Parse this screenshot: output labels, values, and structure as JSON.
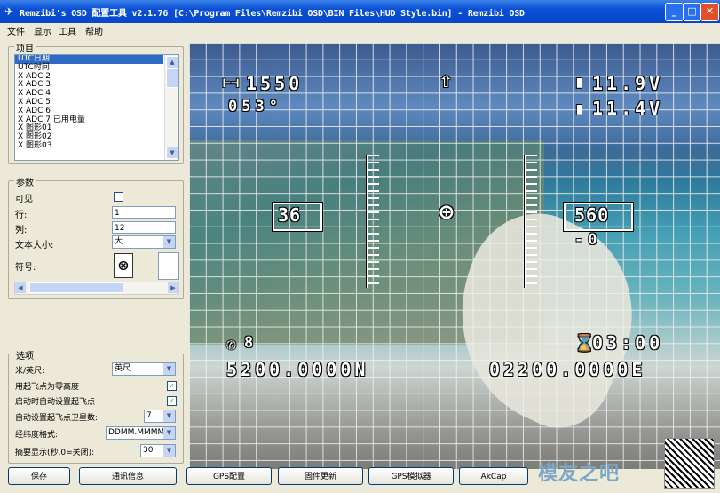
{
  "window": {
    "title": "Remzibi's OSD 配置工具 v2.1.76 [C:\\Program Files\\Remzibi OSD\\BIN Files\\HUD Style.bin] - Remzibi OSD",
    "min_label": "_",
    "max_label": "□",
    "close_label": "✕"
  },
  "menu": [
    "文件",
    "显示",
    "工具",
    "帮助"
  ],
  "items_group": {
    "label": "项目",
    "items": [
      "UTC日期",
      "UTC时间",
      "X ADC 2",
      "X ADC 3",
      "X ADC 4",
      "X ADC 5",
      "X ADC 6",
      "X ADC 7 已用电量",
      "X 图形01",
      "X 图形02",
      "X 图形03"
    ],
    "selected_index": 0
  },
  "params_group": {
    "label": "参数",
    "visible_label": "可见",
    "visible_checked": false,
    "row_label": "行:",
    "row_value": "1",
    "col_label": "列:",
    "col_value": "12",
    "fontsize_label": "文本大小:",
    "fontsize_value": "大",
    "symbol_label": "符号:",
    "symbol_glyph": "⊗"
  },
  "options_group": {
    "label": "选项",
    "unit_label": "米/英尺:",
    "unit_value": "英尺",
    "use_home_alt_label": "用起飞点为零高度",
    "use_home_alt_checked": true,
    "auto_set_home_label": "启动时自动设置起飞点",
    "auto_set_home_checked": true,
    "auto_sat_label": "自动设置起飞点卫星数:",
    "auto_sat_value": "7",
    "coord_format_label": "经纬度格式:",
    "coord_format_value": "DDMM.MMMM",
    "summary_label": "摘要显示(秒,0=关闭):",
    "summary_value": "30"
  },
  "buttons": {
    "save": "保存",
    "comm": "通讯信息",
    "gps_config": "GPS配置",
    "firmware": "固件更新",
    "gps_sim": "GPS模拟器",
    "akcap": "AkCap"
  },
  "hud": {
    "top_left_value": "1550",
    "heading": "053°",
    "volt1": "11.9V",
    "volt2": "11.4V",
    "speed_box": "36",
    "alt_box": "560",
    "vario": "-0",
    "sats": "8",
    "time": "03:00",
    "lat": "5200.0000N",
    "lon": "02200.0000E"
  },
  "watermark": "模友之吧"
}
